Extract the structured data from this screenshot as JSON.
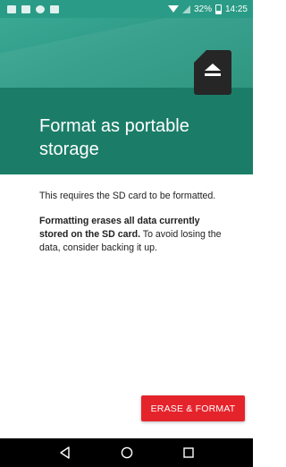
{
  "status_bar": {
    "battery_percent": "32%",
    "time": "14:25",
    "icons": [
      "notification-icon",
      "notification-icon",
      "chat-bubble-icon",
      "delete-icon",
      "wifi-icon",
      "signal-icon",
      "battery-icon"
    ]
  },
  "hero": {
    "title": "Format as portable storage",
    "icon": "sd-card-eject-icon"
  },
  "body": {
    "intro": "This requires the SD card to be formatted.",
    "warning_bold": "Formatting erases all data currently stored on the SD card.",
    "warning_rest": " To avoid losing the data, consider backing it up."
  },
  "actions": {
    "erase_format_label": "ERASE & FORMAT"
  },
  "navigation": {
    "icons": [
      "back-icon",
      "home-icon",
      "recents-icon"
    ]
  },
  "colors": {
    "header_teal": "#2a9b86",
    "header_dark_teal": "#1b7d68",
    "button_red": "#e5232b"
  }
}
